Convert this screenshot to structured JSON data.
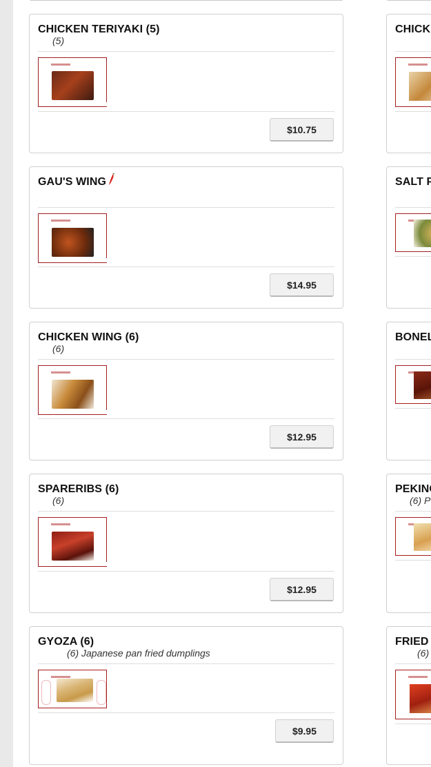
{
  "colors": {
    "accent": "#a31d1d",
    "pepper": "#d8281f"
  },
  "left_column": [
    {
      "title": "CHICKEN TERIYAKI (5)",
      "desc": "(5)",
      "price": "$10.75",
      "icon": null
    },
    {
      "title": "GAU'S WING",
      "desc": "",
      "price": "$14.95",
      "icon": "chili-pepper-icon"
    },
    {
      "title": "CHICKEN WING (6)",
      "desc": "(6)",
      "price": "$12.95",
      "icon": null
    },
    {
      "title": "SPARERIBS (6)",
      "desc": "(6)",
      "price": "$12.95",
      "icon": null
    },
    {
      "title": "GYOZA (6)",
      "desc": "(6) Japanese pan fried dumplings",
      "price": "$9.95",
      "icon": null
    }
  ],
  "right_column": [
    {
      "title": "CHICK",
      "desc": ""
    },
    {
      "title": "SALT P",
      "desc": ""
    },
    {
      "title": "BONEL",
      "desc": ""
    },
    {
      "title": "PEKING",
      "desc": "(6) P"
    },
    {
      "title": "FRIED",
      "desc": "(6)"
    }
  ]
}
